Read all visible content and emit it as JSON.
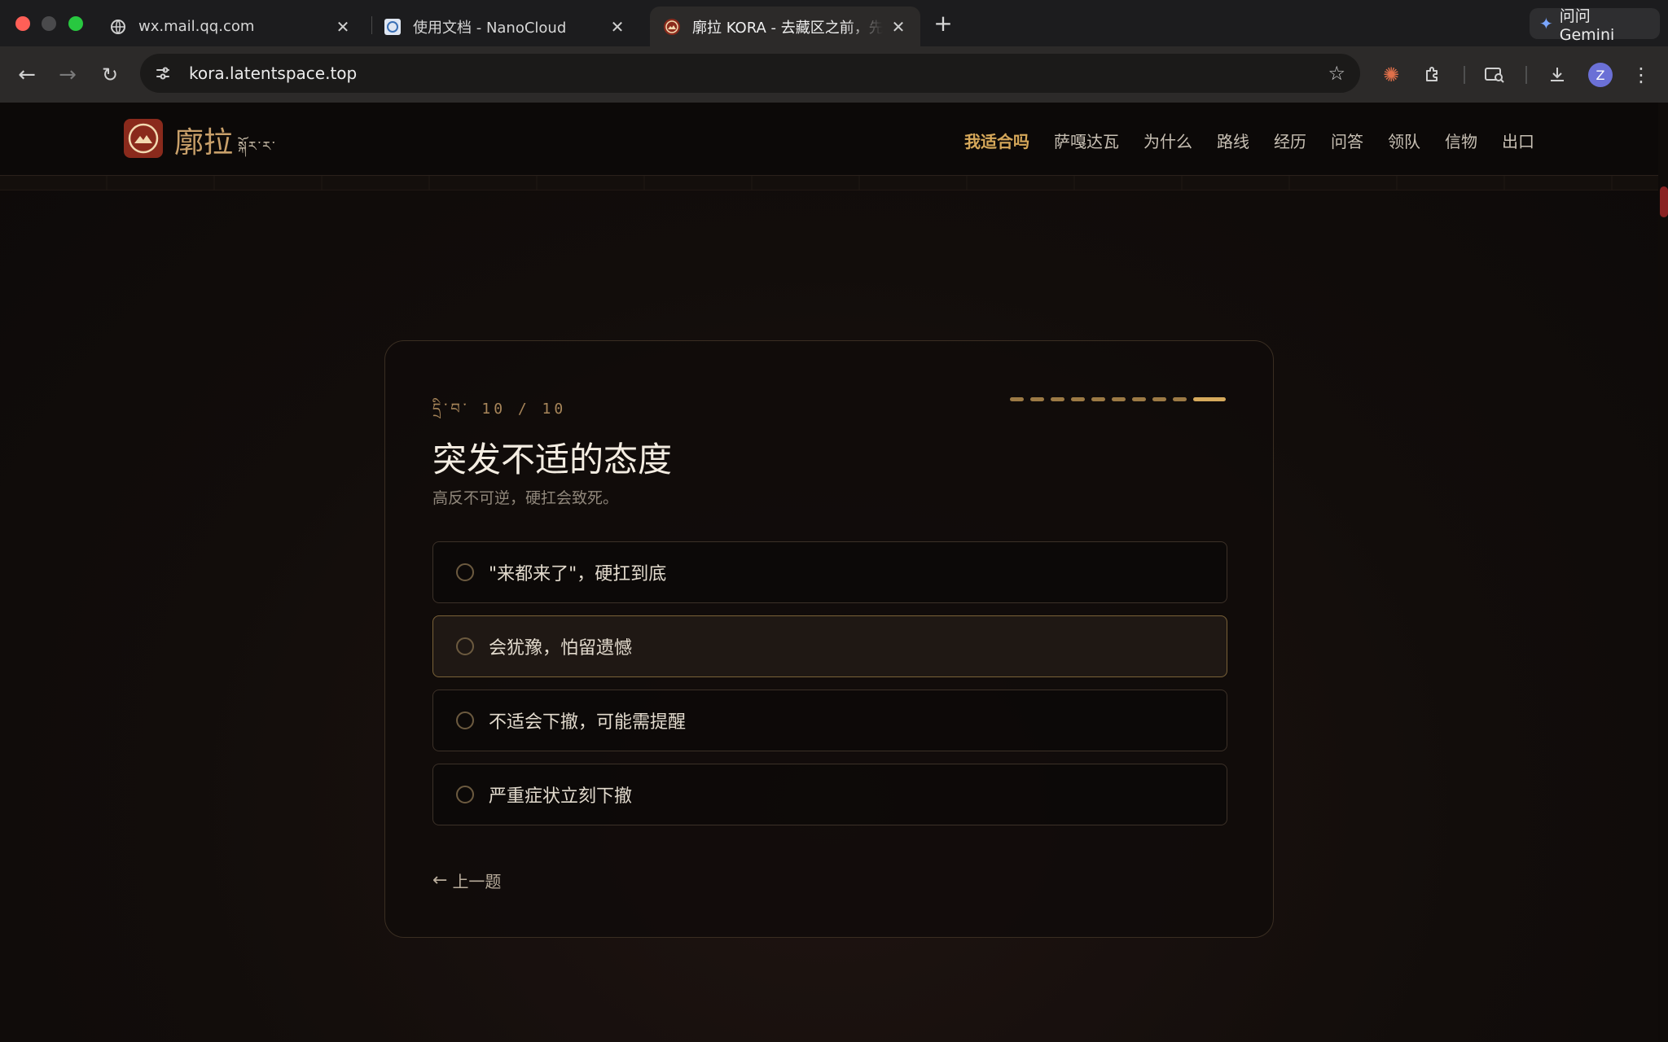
{
  "browser": {
    "tabs": [
      {
        "title": "wx.mail.qq.com",
        "icon": "globe-icon"
      },
      {
        "title": "使用文档 - NanoCloud",
        "icon": "nanocloud-icon"
      },
      {
        "title": "廓拉 KORA - 去藏区之前，先学",
        "icon": "kora-icon",
        "active": true
      }
    ],
    "gemini_label": "问问 Gemini",
    "url": "kora.latentspace.top",
    "profile_initial": "Z"
  },
  "site": {
    "logo_title": "廓拉",
    "logo_subtitle": "སྐོར་ར་",
    "nav": [
      {
        "label": "我适合吗",
        "active": true
      },
      {
        "label": "萨嘎达瓦"
      },
      {
        "label": "为什么"
      },
      {
        "label": "路线"
      },
      {
        "label": "经历"
      },
      {
        "label": "问答"
      },
      {
        "label": "领队"
      },
      {
        "label": "信物"
      },
      {
        "label": "出口"
      }
    ]
  },
  "quiz": {
    "counter": "དྲི་བ་ 10 / 10",
    "progress": {
      "current": 10,
      "total": 10
    },
    "title": "突发不适的态度",
    "subtitle": "高反不可逆，硬扛会致死。",
    "options": [
      "\"来都来了\"，硬扛到底",
      "会犹豫，怕留遗憾",
      "不适会下撤，可能需提醒",
      "严重症状立刻下撤"
    ],
    "prev_label": "上一题"
  },
  "colors": {
    "accent": "#d6a85a",
    "logo_bg": "#8a2a1c",
    "scroll_thumb": "#8a2222"
  }
}
